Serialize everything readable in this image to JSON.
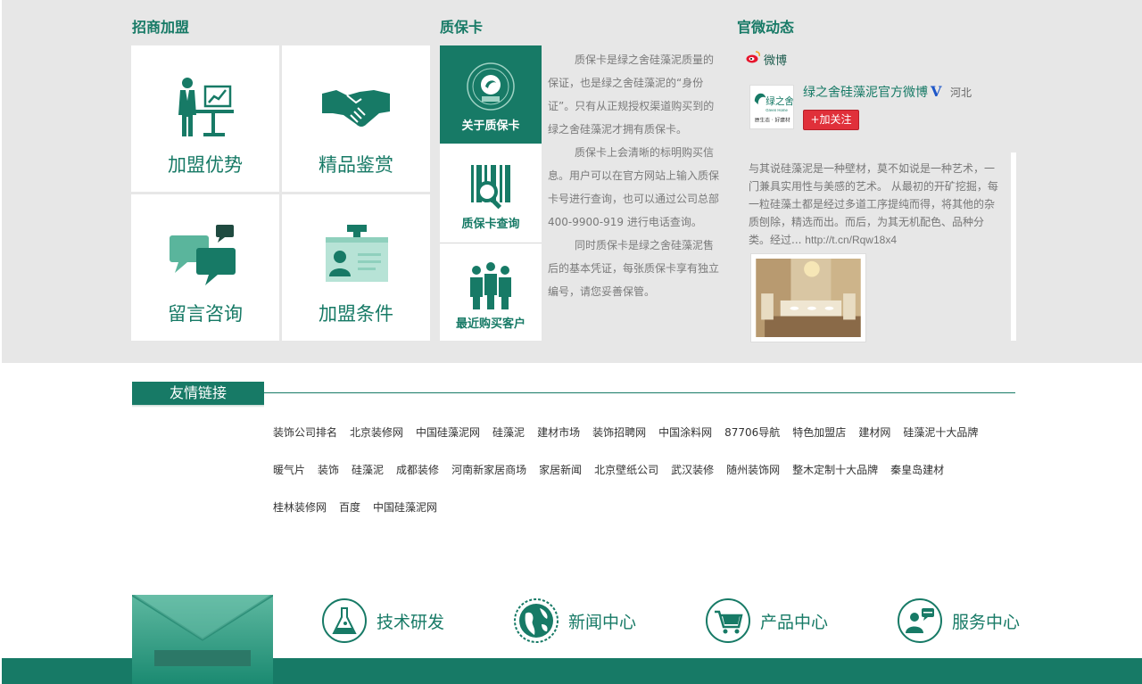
{
  "sections": {
    "join_title": "招商加盟",
    "warranty_title": "质保卡",
    "weibo_title": "官微动态"
  },
  "join_tiles": [
    {
      "label": "加盟优势",
      "icon": "business-man-icon"
    },
    {
      "label": "精品鉴赏",
      "icon": "handshake-icon"
    },
    {
      "label": "留言咨询",
      "icon": "chat-bubbles-icon"
    },
    {
      "label": "加盟条件",
      "icon": "id-card-icon"
    }
  ],
  "warranty": {
    "menu": [
      {
        "label": "关于质保卡",
        "icon": "warranty-seal-icon"
      },
      {
        "label": "质保卡查询",
        "icon": "barcode-search-icon"
      },
      {
        "label": "最近购买客户",
        "icon": "people-group-icon"
      }
    ],
    "paragraphs": [
      "质保卡是绿之舍硅藻泥质量的保证，也是绿之舍硅藻泥的“身份证”。只有从正规授权渠道购买到的绿之舍硅藻泥才拥有质保卡。",
      "质保卡上会清晰的标明购买信息。用户可以在官方网站上输入质保卡号进行查询，也可以通过公司总部 400-9900-919 进行电话查询。",
      "同时质保卡是绿之舍硅藻泥售后的基本凭证，每张质保卡享有独立编号，请您妥善保管。"
    ]
  },
  "weibo": {
    "brand": "微博",
    "account_name": "绿之舍硅藻泥官方微博",
    "verified_mark": "V",
    "region": "河北",
    "follow_label": "+加关注",
    "avatar_brand": "绿之舍",
    "avatar_brand_en": "Green Home",
    "avatar_slogan": "原生态 · 好建材",
    "post_text": "与其说硅藻泥是一种壁材，莫不如说是一种艺术，一门兼具实用性与美感的艺术。 从最初的开矿挖掘，每一粒硅藻土都是经过多道工序提纯而得，将其他的杂质刨除，精选而出。而后，为其无机配色、品种分类。经过... ",
    "post_link": "http://t.cn/Rqw18x4"
  },
  "friend_links": {
    "title": "友情链接",
    "links": [
      "装饰公司排名",
      "北京装修网",
      "中国硅藻泥网",
      "硅藻泥",
      "建材市场",
      "装饰招聘网",
      "中国涂料网",
      "87706导航",
      "特色加盟店",
      "建材网",
      "硅藻泥十大品牌",
      "暖气片",
      "装饰",
      "硅藻泥",
      "成都装修",
      "河南新家居商场",
      "家居新闻",
      "北京壁纸公司",
      "武汉装修",
      "随州装饰网",
      "整木定制十大品牌",
      "秦皇岛建材",
      "桂林装修网",
      "百度",
      "中国硅藻泥网"
    ]
  },
  "services": [
    {
      "label": "技术研发",
      "icon": "flask-icon"
    },
    {
      "label": "新闻中心",
      "icon": "globe-icon"
    },
    {
      "label": "产品中心",
      "icon": "cart-icon"
    },
    {
      "label": "服务中心",
      "icon": "customer-service-icon"
    }
  ],
  "colors": {
    "brand_green": "#177a66",
    "follow_red": "#e0303a",
    "verified_blue": "#1d56c8"
  }
}
